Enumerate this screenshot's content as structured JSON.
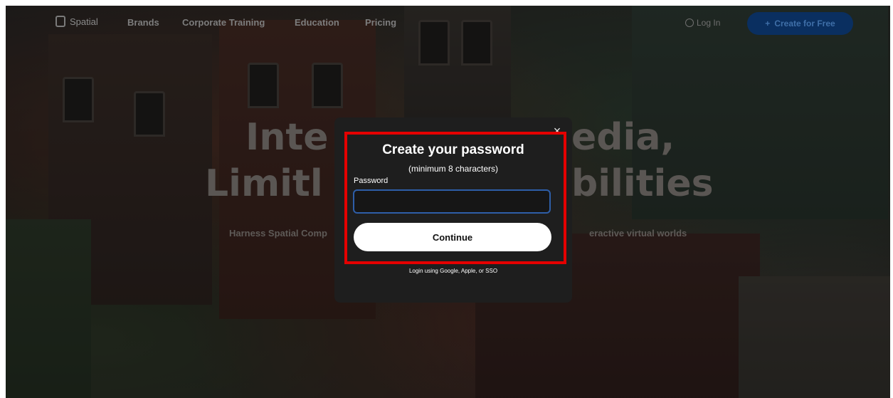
{
  "nav": {
    "logo_text": "Spatial",
    "links": [
      "Brands",
      "Corporate Training",
      "Education",
      "Pricing"
    ],
    "login": "Log In",
    "create_button": "Create for Free"
  },
  "hero": {
    "line1_left": "Inte",
    "line1_right": "edia,",
    "line2_left": "Limitl",
    "line2_right": "bilities",
    "subtitle_left": "Harness Spatial Comp",
    "subtitle_right": "eractive virtual worlds"
  },
  "modal": {
    "close": "×",
    "title": "Create your password",
    "subtitle": "(minimum 8 characters)",
    "password_label": "Password",
    "password_value": "",
    "continue_label": "Continue",
    "alt_login": "Login using Google, Apple, or SSO"
  },
  "colors": {
    "highlight": "#e50000",
    "input_border": "#2e5ea8",
    "create_button_bg": "#0a2f60"
  }
}
